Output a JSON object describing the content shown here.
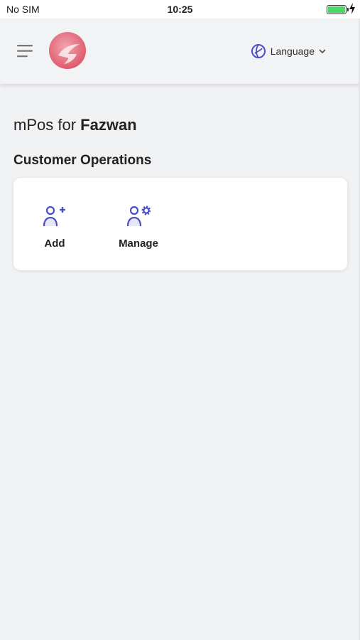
{
  "status_bar": {
    "carrier": "No SIM",
    "time": "10:25",
    "battery_color": "#4cd964"
  },
  "header": {
    "menu_icon": "hamburger-icon",
    "logo_icon": "app-logo",
    "language_label": "Language",
    "language_icon": "globe-icon"
  },
  "greeting": {
    "prefix": "mPos for",
    "name": "Fazwan"
  },
  "customer_operations": {
    "title": "Customer Operations",
    "items": [
      {
        "label": "Add",
        "icon": "add-user-icon"
      },
      {
        "label": "Manage",
        "icon": "manage-user-icon"
      }
    ]
  },
  "colors": {
    "accent": "#4a4fc4",
    "background": "#f1f2f4",
    "logo_red": "#e0566a"
  }
}
